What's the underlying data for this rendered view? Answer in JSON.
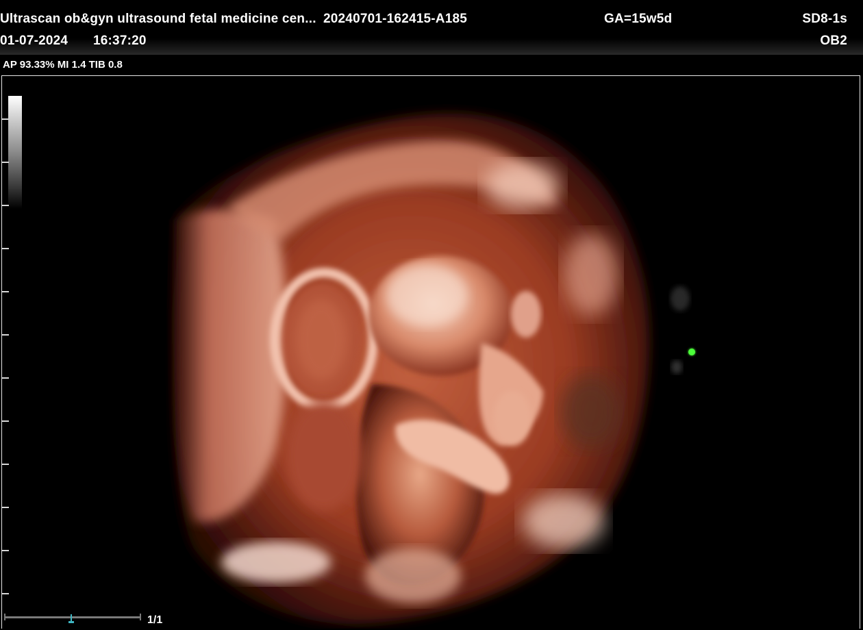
{
  "header": {
    "center_name": "Ultrascan ob&gyn ultrasound fetal medicine cen...",
    "exam_id": "20240701-162415-A185",
    "gestational_age": "GA=15w5d",
    "probe": "SD8-1s",
    "date": "01-07-2024",
    "time": "16:37:20",
    "preset": "OB2"
  },
  "params": {
    "text": "AP 93.33%  MI 1.4 TIB 0.8"
  },
  "footer": {
    "page_indicator": "1/1"
  },
  "colors": {
    "marker_dot": "#4cff3a",
    "tissue_light": "#f2c4ae",
    "tissue_mid": "#c86a4a",
    "tissue_dark": "#5a1a10"
  }
}
